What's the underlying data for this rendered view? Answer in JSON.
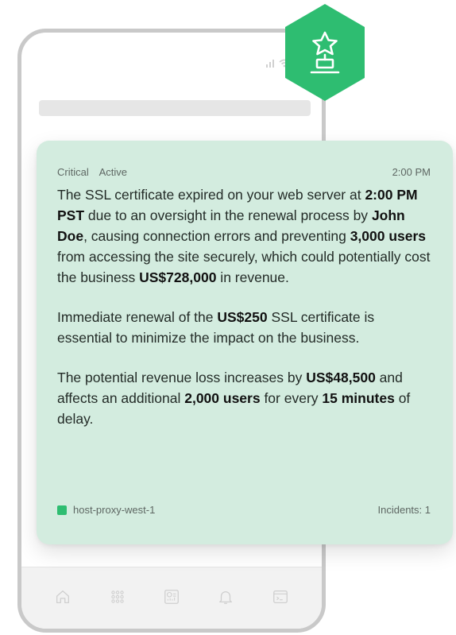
{
  "card": {
    "severity": "Critical",
    "status": "Active",
    "time": "2:00 PM",
    "p1": [
      {
        "t": "The SSL certificate expired on your web server at "
      },
      {
        "t": "2:00 PM PST",
        "b": true
      },
      {
        "t": " due to an oversight in the renewal process by "
      },
      {
        "t": "John Doe",
        "b": true
      },
      {
        "t": ", causing connection errors and preventing "
      },
      {
        "t": "3,000 users",
        "b": true
      },
      {
        "t": " from accessing the site securely, which could potentially cost the business "
      },
      {
        "t": "US$728,000",
        "b": true
      },
      {
        "t": " in revenue."
      }
    ],
    "p2": [
      {
        "t": "Immediate renewal of the "
      },
      {
        "t": "US$250",
        "b": true
      },
      {
        "t": " SSL certificate is essential to minimize the impact on the business."
      }
    ],
    "p3": [
      {
        "t": "The potential revenue loss increases by "
      },
      {
        "t": "US$48,500",
        "b": true
      },
      {
        "t": " and affects an additional "
      },
      {
        "t": "2,000 users",
        "b": true
      },
      {
        "t": " for every "
      },
      {
        "t": "15 minutes",
        "b": true
      },
      {
        "t": " of delay."
      }
    ],
    "host": "host-proxy-west-1",
    "incidents": "Incidents: 1"
  },
  "colors": {
    "card_bg": "#d3ecdf",
    "badge": "#2ebd71",
    "host_swatch": "#2ebd71"
  },
  "icons": {
    "badge": "trophy-icon",
    "tabs": [
      "home-icon",
      "apps-grid-icon",
      "dashboard-icon",
      "bell-icon",
      "terminal-icon"
    ]
  }
}
